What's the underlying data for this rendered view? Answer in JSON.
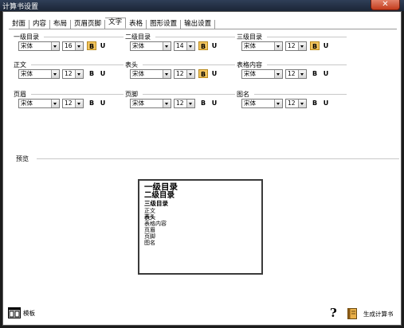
{
  "window": {
    "title": "计算书设置",
    "close_glyph": "✕"
  },
  "tabs": [
    {
      "label": "封面",
      "active": false
    },
    {
      "label": "内容",
      "active": false
    },
    {
      "label": "布局",
      "active": false
    },
    {
      "label": "页眉页脚",
      "active": false
    },
    {
      "label": "文字",
      "active": true
    },
    {
      "label": "表格",
      "active": false
    },
    {
      "label": "图形设置",
      "active": false
    },
    {
      "label": "输出设置",
      "active": false
    }
  ],
  "font_groups": [
    {
      "label": "一级目录",
      "font": "宋体",
      "size": "16",
      "bold_label": "B",
      "bold_on": true,
      "underline_label": "U"
    },
    {
      "label": "二级目录",
      "font": "宋体",
      "size": "14",
      "bold_label": "B",
      "bold_on": true,
      "underline_label": "U"
    },
    {
      "label": "三级目录",
      "font": "宋体",
      "size": "12",
      "bold_label": "B",
      "bold_on": true,
      "underline_label": "U"
    },
    {
      "label": "正文",
      "font": "宋体",
      "size": "12",
      "bold_label": "B",
      "bold_on": false,
      "underline_label": "U"
    },
    {
      "label": "表头",
      "font": "宋体",
      "size": "12",
      "bold_label": "B",
      "bold_on": true,
      "underline_label": "U"
    },
    {
      "label": "表格内容",
      "font": "宋体",
      "size": "12",
      "bold_label": "B",
      "bold_on": false,
      "underline_label": "U"
    },
    {
      "label": "页眉",
      "font": "宋体",
      "size": "12",
      "bold_label": "B",
      "bold_on": false,
      "underline_label": "U"
    },
    {
      "label": "页脚",
      "font": "宋体",
      "size": "12",
      "bold_label": "B",
      "bold_on": false,
      "underline_label": "U"
    },
    {
      "label": "图名",
      "font": "宋体",
      "size": "12",
      "bold_label": "B",
      "bold_on": false,
      "underline_label": "U"
    }
  ],
  "preview": {
    "label": "预览",
    "lines": [
      "一级目录",
      "二级目录",
      "三级目录",
      "正文",
      "表头",
      "表格内容",
      "页眉",
      "页脚",
      "图名"
    ]
  },
  "footer": {
    "template_label": "模板",
    "help_glyph": "?",
    "generate_label": "生成计算书"
  },
  "colors": {
    "bold_active": "#f3c65f",
    "titlebar": "#2f3e57",
    "close": "#c33b1c"
  }
}
